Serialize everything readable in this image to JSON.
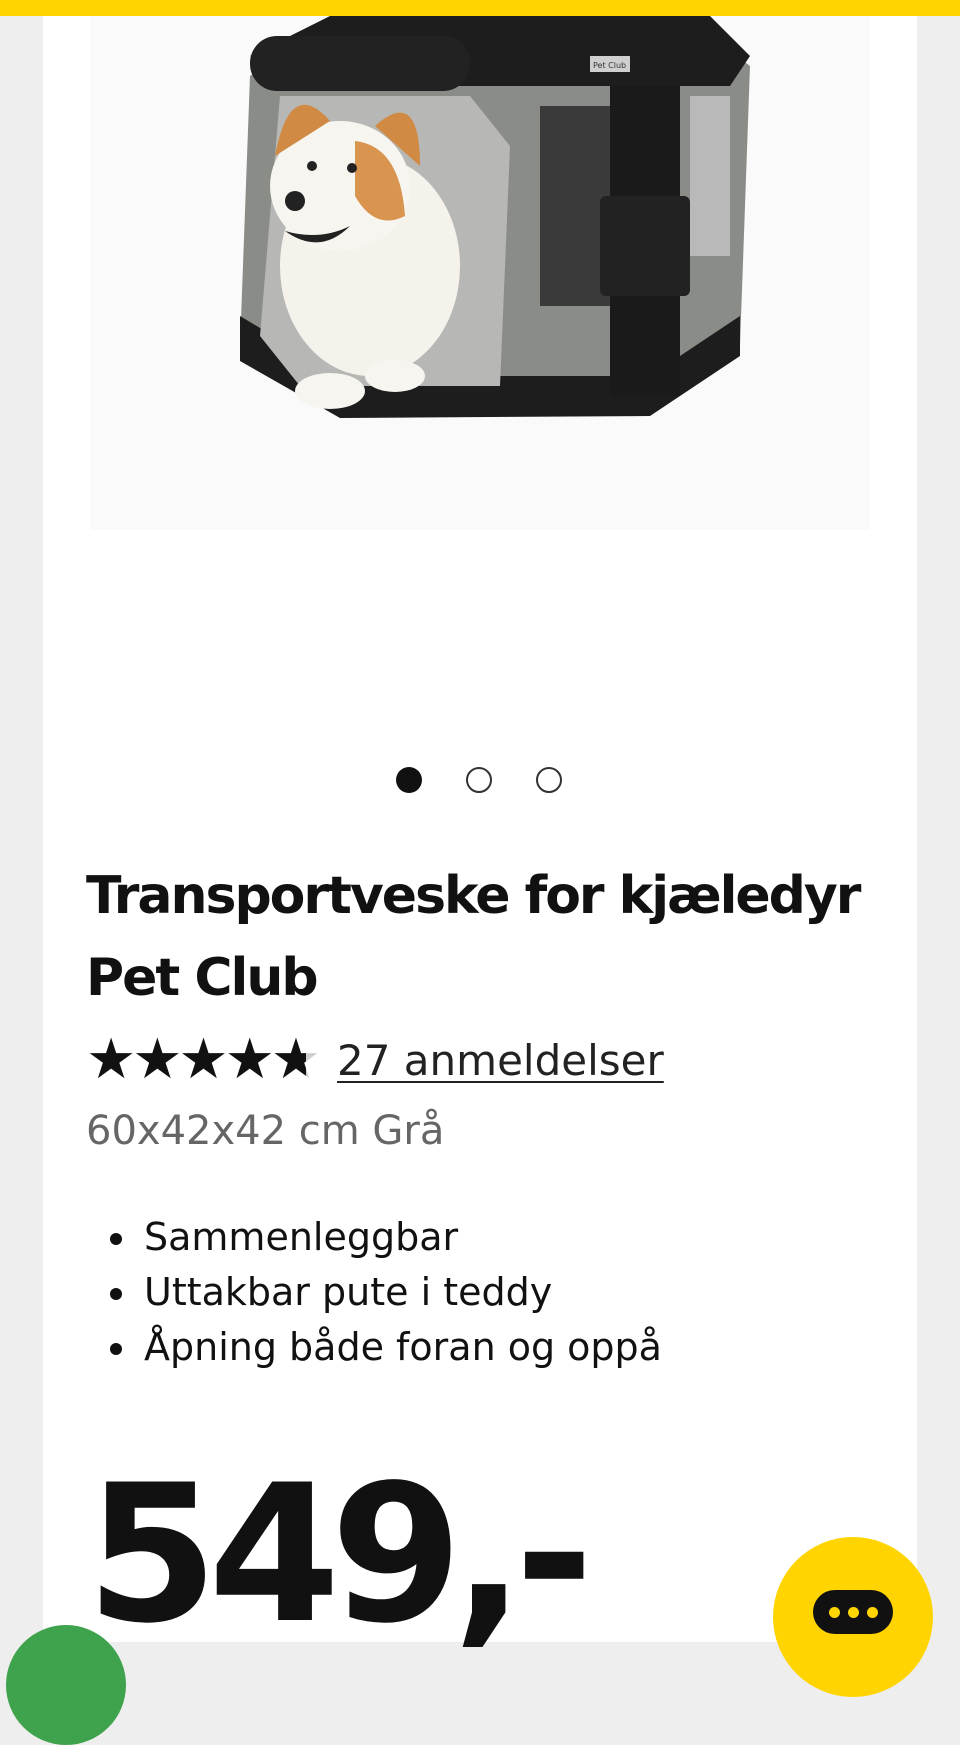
{
  "product": {
    "title": "Transportveske for kjæledyr Pet Club",
    "rating": 4.7,
    "reviews_label": "27 anmeldelser",
    "variant": "60x42x42 cm Grå",
    "features": [
      "Sammenleggbar",
      "Uttakbar pute i teddy",
      "Åpning både foran og oppå"
    ],
    "price": "549,-",
    "image_icon": "dog-in-pet-carrier-image",
    "carrier_logo_text": "Pet Club"
  },
  "carousel": {
    "slide_count": 3,
    "active_index": 0
  },
  "colors": {
    "accent": "#ffd400",
    "text": "#111111",
    "muted": "#666666",
    "green": "#3fa34d"
  }
}
